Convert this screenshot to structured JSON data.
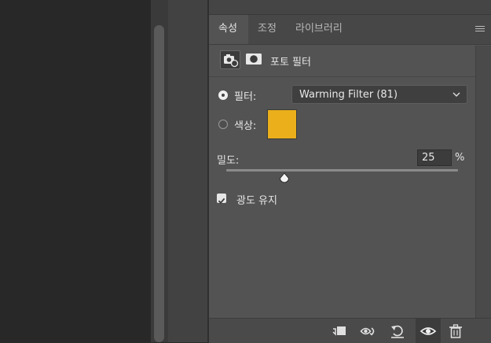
{
  "tabs": [
    {
      "label": "속성",
      "active": true
    },
    {
      "label": "조정",
      "active": false
    },
    {
      "label": "라이브러리",
      "active": false
    }
  ],
  "panel_menu_icon": "hamburger-icon",
  "adjustment": {
    "title": "포토 필터",
    "icons": [
      "adjustment-layer-camera-icon",
      "layer-mask-icon"
    ]
  },
  "filter": {
    "label": "필터:",
    "selected": true,
    "value": "Warming Filter (81)"
  },
  "color": {
    "label": "색상:",
    "selected": false,
    "swatch": "#eaaf1b"
  },
  "density": {
    "label": "밀도:",
    "value": "25",
    "unit": "%",
    "percent": 25
  },
  "preserve_luminosity": {
    "label": "광도 유지",
    "checked": true
  },
  "bottom_toolbar": [
    "clip-to-layer-icon",
    "view-previous-state-icon",
    "reset-icon",
    "visibility-eye-icon",
    "trash-icon"
  ],
  "colors": {
    "panel_bg": "#535353",
    "workspace_bg": "#282828",
    "swatch": "#eaaf1b"
  }
}
